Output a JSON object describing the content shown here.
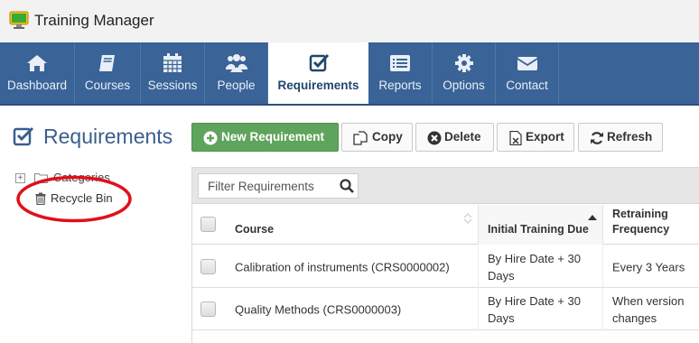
{
  "app": {
    "title": "Training Manager",
    "logo_icon": "monitor-app-icon"
  },
  "nav": {
    "items": [
      {
        "label": "Dashboard",
        "icon": "home-icon"
      },
      {
        "label": "Courses",
        "icon": "book-icon"
      },
      {
        "label": "Sessions",
        "icon": "calendar-icon"
      },
      {
        "label": "People",
        "icon": "users-icon"
      },
      {
        "label": "Requirements",
        "icon": "check-square-icon",
        "active": true
      },
      {
        "label": "Reports",
        "icon": "list-alt-icon"
      },
      {
        "label": "Options",
        "icon": "cog-icon"
      },
      {
        "label": "Contact",
        "icon": "envelope-icon"
      }
    ]
  },
  "page": {
    "heading": "Requirements"
  },
  "tree": {
    "categories_label": "Categories",
    "recycle_bin_label": "Recycle Bin"
  },
  "toolbar": {
    "new_label": "New Requirement",
    "copy_label": "Copy",
    "delete_label": "Delete",
    "export_label": "Export",
    "refresh_label": "Refresh"
  },
  "grid": {
    "filter_placeholder": "Filter Requirements",
    "columns": {
      "course": "Course",
      "initial_due": "Initial Training Due",
      "retraining_line1": "Retraining",
      "retraining_line2": "Frequency"
    },
    "rows": [
      {
        "course": "Calibration of instruments (CRS0000002)",
        "due_line1": "By Hire Date + 30",
        "due_line2": "Days",
        "freq_line1": "Every 3 Years",
        "freq_line2": ""
      },
      {
        "course": "Quality Methods (CRS0000003)",
        "due_line1": "By Hire Date + 30",
        "due_line2": "Days",
        "freq_line1": "When version",
        "freq_line2": "changes"
      }
    ]
  },
  "colors": {
    "nav_bg": "#3a6397",
    "accent_green": "#5fa45c",
    "annotation_red": "#e0101a",
    "heading_blue": "#3a5f8c"
  }
}
